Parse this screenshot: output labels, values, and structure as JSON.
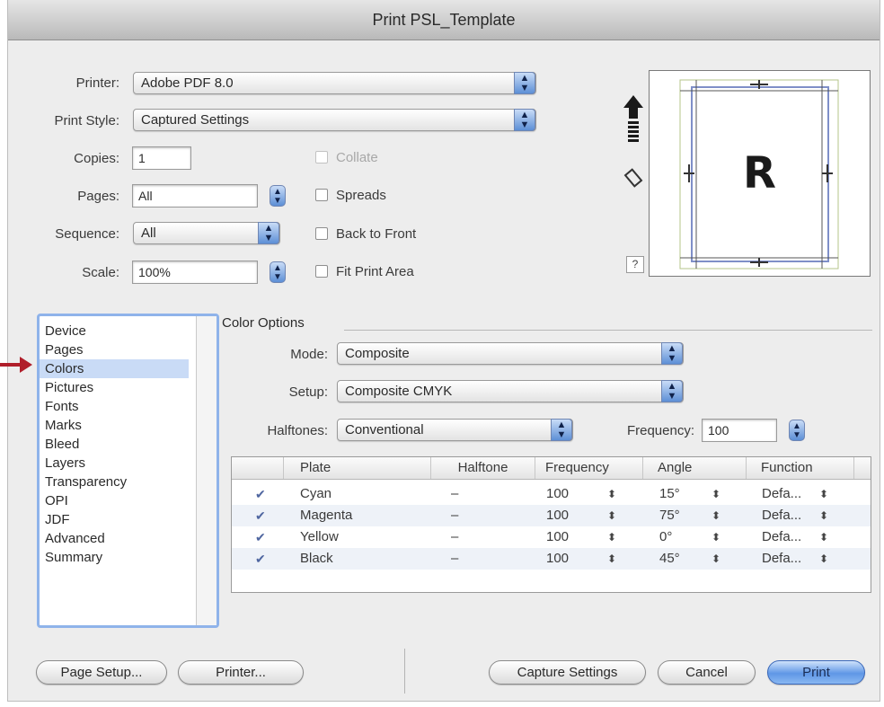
{
  "window": {
    "title": "Print PSL_Template"
  },
  "printer": {
    "label": "Printer:",
    "value": "Adobe PDF 8.0"
  },
  "print_style": {
    "label": "Print Style:",
    "value": "Captured Settings"
  },
  "copies": {
    "label": "Copies:",
    "value": "1"
  },
  "pages": {
    "label": "Pages:",
    "value": "All"
  },
  "sequence": {
    "label": "Sequence:",
    "value": "All"
  },
  "scale": {
    "label": "Scale:",
    "value": "100%"
  },
  "options": {
    "collate": "Collate",
    "spreads": "Spreads",
    "back_to_front": "Back to Front",
    "fit_print_area": "Fit Print Area"
  },
  "preview": {
    "letter": "R",
    "help": "?"
  },
  "sidebar": {
    "items": [
      {
        "label": "Device"
      },
      {
        "label": "Pages"
      },
      {
        "label": "Colors"
      },
      {
        "label": "Pictures"
      },
      {
        "label": "Fonts"
      },
      {
        "label": "Marks"
      },
      {
        "label": "Bleed"
      },
      {
        "label": "Layers"
      },
      {
        "label": "Transparency"
      },
      {
        "label": "OPI"
      },
      {
        "label": "JDF"
      },
      {
        "label": "Advanced"
      },
      {
        "label": "Summary"
      }
    ],
    "selected": "Colors"
  },
  "color_options": {
    "title": "Color Options",
    "mode": {
      "label": "Mode:",
      "value": "Composite"
    },
    "setup": {
      "label": "Setup:",
      "value": "Composite CMYK"
    },
    "halftones": {
      "label": "Halftones:",
      "value": "Conventional"
    },
    "frequency": {
      "label": "Frequency:",
      "value": "100"
    }
  },
  "plates_table": {
    "columns": [
      "Plate",
      "Halftone",
      "Frequency",
      "Angle",
      "Function"
    ],
    "rows": [
      {
        "plate": "Cyan",
        "halftone": "–",
        "frequency": "100",
        "angle": "15°",
        "function": "Defa...",
        "checked": true
      },
      {
        "plate": "Magenta",
        "halftone": "–",
        "frequency": "100",
        "angle": "75°",
        "function": "Defa...",
        "checked": true
      },
      {
        "plate": "Yellow",
        "halftone": "–",
        "frequency": "100",
        "angle": "0°",
        "function": "Defa...",
        "checked": true
      },
      {
        "plate": "Black",
        "halftone": "–",
        "frequency": "100",
        "angle": "45°",
        "function": "Defa...",
        "checked": true
      }
    ]
  },
  "buttons": {
    "page_setup": "Page Setup...",
    "printer": "Printer...",
    "capture_settings": "Capture Settings",
    "cancel": "Cancel",
    "print": "Print"
  },
  "colors": {
    "selection": "#c9dbf6",
    "focus_ring": "#8fb3ea",
    "default_button": "#5f97e6",
    "annotation_arrow": "#b01e2a"
  }
}
